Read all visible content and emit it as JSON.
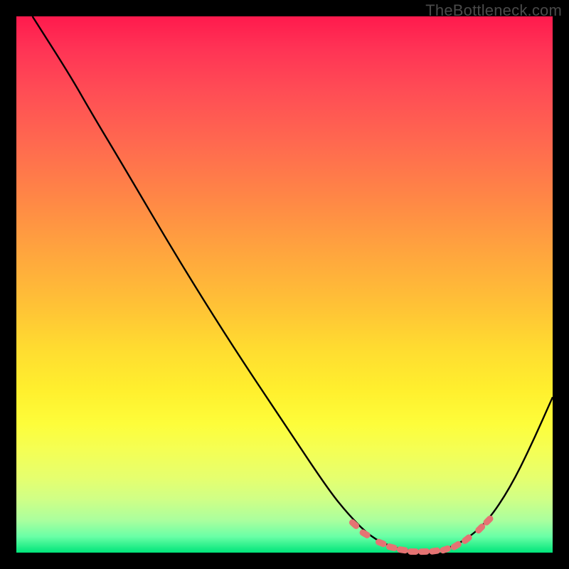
{
  "watermark": "TheBottleneck.com",
  "colors": {
    "frame": "#000000",
    "curve": "#000000",
    "marker": "#e57373",
    "gradient_top": "#ff1a4d",
    "gradient_bottom": "#00e57a"
  },
  "chart_data": {
    "type": "line",
    "title": "",
    "xlabel": "",
    "ylabel": "",
    "xlim": [
      0,
      100
    ],
    "ylim": [
      0,
      100
    ],
    "grid": false,
    "curve": [
      {
        "x": 3,
        "y": 100
      },
      {
        "x": 10,
        "y": 89
      },
      {
        "x": 14,
        "y": 82
      },
      {
        "x": 20,
        "y": 72
      },
      {
        "x": 30,
        "y": 55
      },
      {
        "x": 40,
        "y": 39
      },
      {
        "x": 50,
        "y": 24
      },
      {
        "x": 58,
        "y": 12
      },
      {
        "x": 62,
        "y": 7
      },
      {
        "x": 66,
        "y": 3
      },
      {
        "x": 70,
        "y": 1
      },
      {
        "x": 75,
        "y": 0
      },
      {
        "x": 80,
        "y": 0.5
      },
      {
        "x": 84,
        "y": 2.5
      },
      {
        "x": 88,
        "y": 6
      },
      {
        "x": 92,
        "y": 12
      },
      {
        "x": 96,
        "y": 20
      },
      {
        "x": 100,
        "y": 29
      }
    ],
    "markers": [
      {
        "x": 63,
        "y": 5.3
      },
      {
        "x": 65,
        "y": 3.5
      },
      {
        "x": 68,
        "y": 1.8
      },
      {
        "x": 70,
        "y": 1.0
      },
      {
        "x": 72,
        "y": 0.5
      },
      {
        "x": 74,
        "y": 0.2
      },
      {
        "x": 76,
        "y": 0.2
      },
      {
        "x": 78,
        "y": 0.3
      },
      {
        "x": 80,
        "y": 0.6
      },
      {
        "x": 82,
        "y": 1.3
      },
      {
        "x": 84,
        "y": 2.5
      },
      {
        "x": 86.5,
        "y": 4.5
      },
      {
        "x": 88,
        "y": 6.0
      }
    ]
  }
}
